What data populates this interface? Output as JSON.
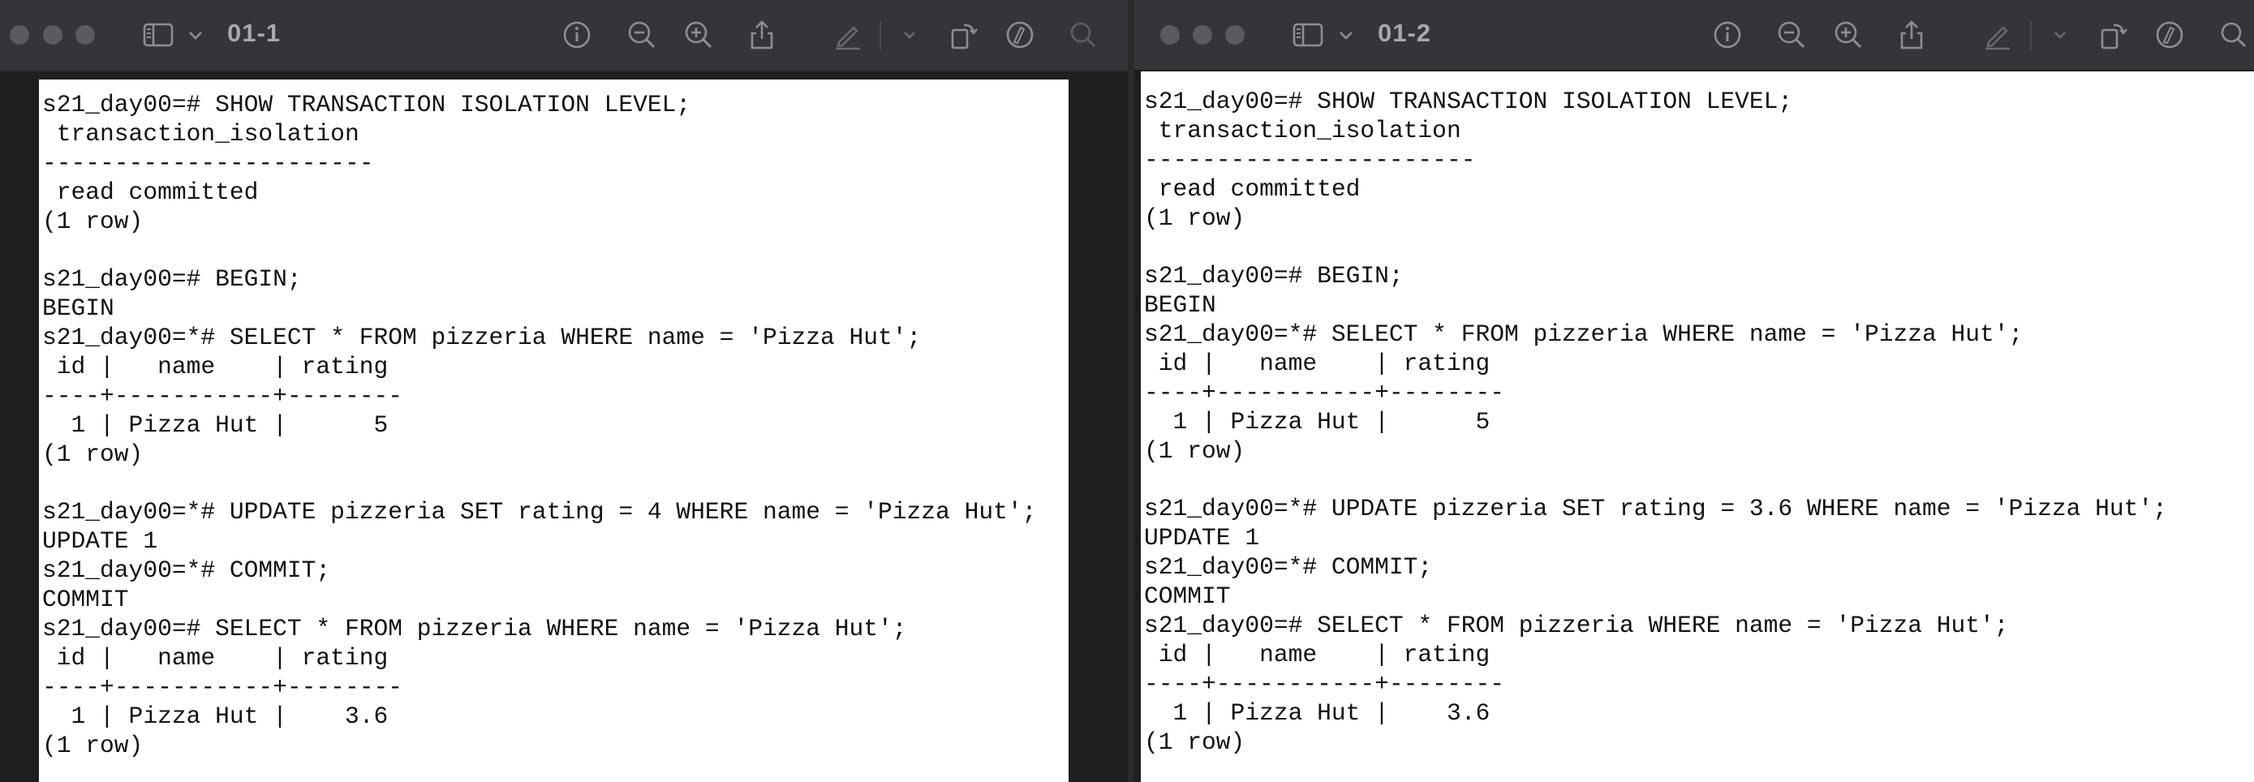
{
  "windows": [
    {
      "title": "01-1",
      "lines": [
        "s21_day00=# SHOW TRANSACTION ISOLATION LEVEL;",
        " transaction_isolation",
        "-----------------------",
        " read committed",
        "(1 row)",
        "",
        "s21_day00=# BEGIN;",
        "BEGIN",
        "s21_day00=*# SELECT * FROM pizzeria WHERE name = 'Pizza Hut';",
        " id |   name    | rating",
        "----+-----------+--------",
        "  1 | Pizza Hut |      5",
        "(1 row)",
        "",
        "s21_day00=*# UPDATE pizzeria SET rating = 4 WHERE name = 'Pizza Hut';",
        "UPDATE 1",
        "s21_day00=*# COMMIT;",
        "COMMIT",
        "s21_day00=# SELECT * FROM pizzeria WHERE name = 'Pizza Hut';",
        " id |   name    | rating",
        "----+-----------+--------",
        "  1 | Pizza Hut |    3.6",
        "(1 row)"
      ]
    },
    {
      "title": "01-2",
      "lines": [
        "s21_day00=# SHOW TRANSACTION ISOLATION LEVEL;",
        " transaction_isolation",
        "-----------------------",
        " read committed",
        "(1 row)",
        "",
        "s21_day00=# BEGIN;",
        "BEGIN",
        "s21_day00=*# SELECT * FROM pizzeria WHERE name = 'Pizza Hut';",
        " id |   name    | rating",
        "----+-----------+--------",
        "  1 | Pizza Hut |      5",
        "(1 row)",
        "",
        "s21_day00=*# UPDATE pizzeria SET rating = 3.6 WHERE name = 'Pizza Hut';",
        "UPDATE 1",
        "s21_day00=*# COMMIT;",
        "COMMIT",
        "s21_day00=# SELECT * FROM pizzeria WHERE name = 'Pizza Hut';",
        " id |   name    | rating",
        "----+-----------+--------",
        "  1 | Pizza Hut |    3.6",
        "(1 row)"
      ]
    }
  ],
  "toolbar": {
    "icons": [
      "sidebar-icon",
      "chevron-down-icon",
      "info-icon",
      "zoom-out-icon",
      "zoom-in-icon",
      "share-icon",
      "markup-pen-icon",
      "chevron-down-icon",
      "rotate-icon",
      "markup-circle-icon",
      "search-icon"
    ]
  },
  "colors": {
    "titlebar": "#353539",
    "page": "#ffffff",
    "icon": "#8e8e93"
  }
}
